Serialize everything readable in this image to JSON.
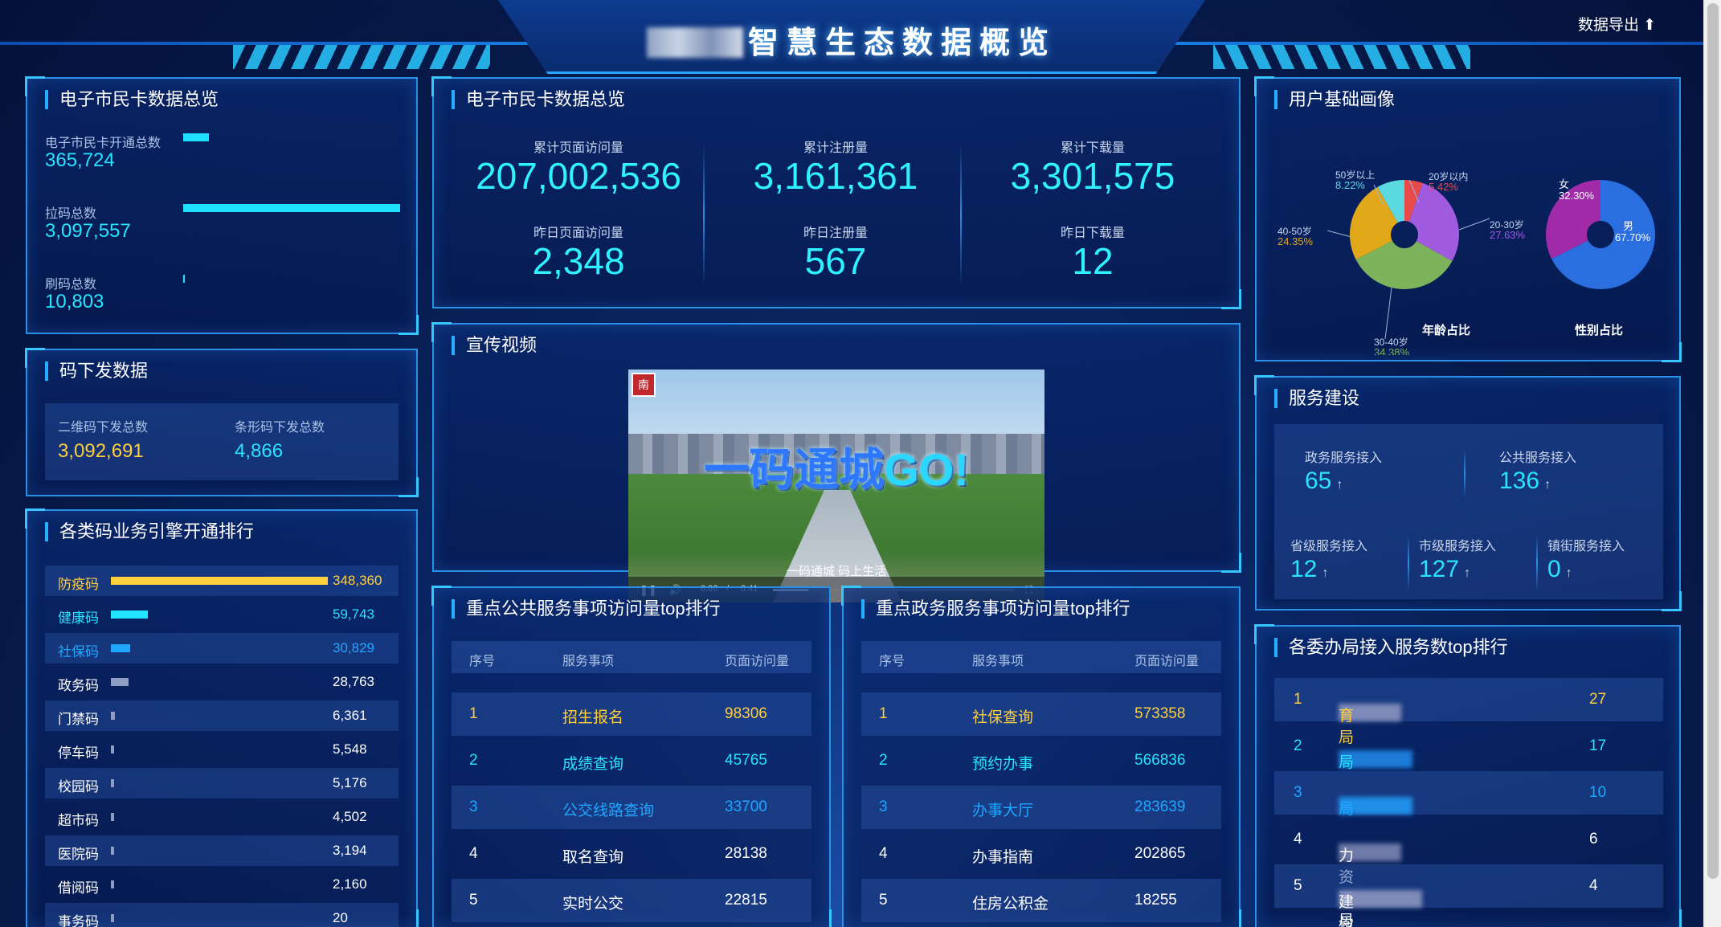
{
  "header": {
    "title": "智慧生态数据概览",
    "export_label": "数据导出"
  },
  "card_overview": {
    "title": "电子市民卡数据总览",
    "items": [
      {
        "label": "电子市民卡开通总数",
        "value": "365,724",
        "ratio": 0.118
      },
      {
        "label": "拉码总数",
        "value": "3,097,557",
        "ratio": 1.0
      },
      {
        "label": "刷码总数",
        "value": "10,803",
        "ratio": 0.004
      }
    ]
  },
  "code_issue": {
    "title": "码下发数据",
    "qr_label": "二维码下发总数",
    "qr_value": "3,092,691",
    "bar_label": "条形码下发总数",
    "bar_value": "4,866"
  },
  "ranking": {
    "title": "各类码业务引擎开通排行",
    "rows": [
      {
        "name": "防疫码",
        "value": "348,360",
        "num": 348360,
        "color": "#ffd13a"
      },
      {
        "name": "健康码",
        "value": "59,743",
        "num": 59743,
        "color": "#22e4ff"
      },
      {
        "name": "社保码",
        "value": "30,829",
        "num": 30829,
        "color": "#1fa7ff"
      },
      {
        "name": "政务码",
        "value": "28,763",
        "num": 28763,
        "color": "#8f9dc4"
      },
      {
        "name": "门禁码",
        "value": "6,361",
        "num": 6361,
        "color": "#8f9dc4"
      },
      {
        "name": "停车码",
        "value": "5,548",
        "num": 5548,
        "color": "#8f9dc4"
      },
      {
        "name": "校园码",
        "value": "5,176",
        "num": 5176,
        "color": "#8f9dc4"
      },
      {
        "name": "超市码",
        "value": "4,502",
        "num": 4502,
        "color": "#8f9dc4"
      },
      {
        "name": "医院码",
        "value": "3,194",
        "num": 3194,
        "color": "#8f9dc4"
      },
      {
        "name": "借阅码",
        "value": "2,160",
        "num": 2160,
        "color": "#8f9dc4"
      },
      {
        "name": "事务码",
        "value": "20",
        "num": 20,
        "color": "#8f9dc4"
      }
    ]
  },
  "stats": {
    "title": "电子市民卡数据总览",
    "cells": [
      {
        "label": "累计页面访问量",
        "value": "207,002,536"
      },
      {
        "label": "累计注册量",
        "value": "3,161,361"
      },
      {
        "label": "累计下载量",
        "value": "3,301,575"
      },
      {
        "label": "昨日页面访问量",
        "value": "2,348"
      },
      {
        "label": "昨日注册量",
        "value": "567"
      },
      {
        "label": "昨日下载量",
        "value": "12"
      }
    ]
  },
  "video": {
    "title": "宣传视频",
    "logo": "南",
    "headline_a": "一码通城",
    "headline_b": "GO!",
    "subtitle": "一码通城 码上生活",
    "time_current": "0:06",
    "time_total": "0:41",
    "progress": 0.146
  },
  "public_top": {
    "title": "重点公共服务事项访问量top排行",
    "headers": [
      "序号",
      "服务事项",
      "页面访问量"
    ],
    "rows": [
      {
        "idx": "1",
        "name": "招生报名",
        "value": "98306",
        "color": "#ffcf3f"
      },
      {
        "idx": "2",
        "name": "成绩查询",
        "value": "45765",
        "color": "#29e3ff"
      },
      {
        "idx": "3",
        "name": "公交线路查询",
        "value": "33700",
        "color": "#1fa7ff"
      },
      {
        "idx": "4",
        "name": "取名查询",
        "value": "28138",
        "color": "#ffffff"
      },
      {
        "idx": "5",
        "name": "实时公交",
        "value": "22815",
        "color": "#ffffff"
      }
    ]
  },
  "gov_top": {
    "title": "重点政务服务事项访问量top排行",
    "headers": [
      "序号",
      "服务事项",
      "页面访问量"
    ],
    "rows": [
      {
        "idx": "1",
        "name": "社保查询",
        "value": "573358",
        "color": "#ffcf3f"
      },
      {
        "idx": "2",
        "name": "预约办事",
        "value": "566836",
        "color": "#29e3ff"
      },
      {
        "idx": "3",
        "name": "办事大厅",
        "value": "283639",
        "color": "#1fa7ff"
      },
      {
        "idx": "4",
        "name": "办事指南",
        "value": "202865",
        "color": "#ffffff"
      },
      {
        "idx": "5",
        "name": "住房公积金",
        "value": "18255",
        "color": "#ffffff"
      }
    ]
  },
  "profile": {
    "title": "用户基础画像",
    "age_title": "年龄占比",
    "gender_title": "性别占比",
    "age": [
      {
        "label": "20岁以内",
        "pct": "5.42%",
        "num": 5.42,
        "color": "#e84a4a"
      },
      {
        "label": "20-30岁",
        "pct": "27.63%",
        "num": 27.63,
        "color": "#a15be0"
      },
      {
        "label": "30-40岁",
        "pct": "34.38%",
        "num": 34.38,
        "color": "#7db35a"
      },
      {
        "label": "40-50岁",
        "pct": "24.35%",
        "num": 24.35,
        "color": "#e0a818"
      },
      {
        "label": "50岁以上",
        "pct": "8.22%",
        "num": 8.22,
        "color": "#5ad9e0"
      }
    ],
    "gender": [
      {
        "label": "男",
        "pct": "67.70%",
        "num": 67.7,
        "color": "#2a6ee0"
      },
      {
        "label": "女",
        "pct": "32.30%",
        "num": 32.3,
        "color": "#a02aa8"
      }
    ]
  },
  "service": {
    "title": "服务建设",
    "top": [
      {
        "label": "政务服务接入",
        "value": "65"
      },
      {
        "label": "公共服务接入",
        "value": "136"
      }
    ],
    "bottom": [
      {
        "label": "省级服务接入",
        "value": "12"
      },
      {
        "label": "市级服务接入",
        "value": "127"
      },
      {
        "label": "镇街服务接入",
        "value": "0"
      }
    ],
    "arrow": "↑"
  },
  "bureau_top": {
    "title": "各委办局接入服务数top排行",
    "rows": [
      {
        "idx": "1",
        "name_tail": "育局",
        "value": "27",
        "color": "#ffcf3f"
      },
      {
        "idx": "2",
        "name_tail": "局",
        "value": "17",
        "color": "#29e3ff"
      },
      {
        "idx": "3",
        "name_tail": "局",
        "value": "10",
        "color": "#1fa7ff"
      },
      {
        "idx": "4",
        "name_tail": "力资源局",
        "value": "6",
        "color": "#ffffff"
      },
      {
        "idx": "5",
        "name_tail": "建设局",
        "value": "4",
        "color": "#ffffff"
      }
    ]
  }
}
